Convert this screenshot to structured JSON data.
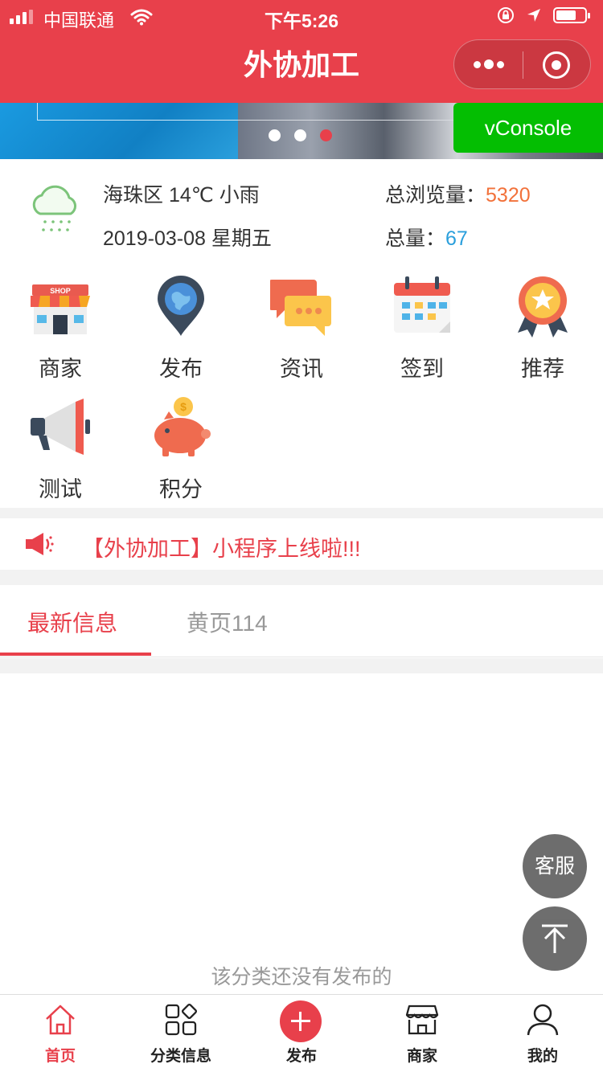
{
  "status_bar": {
    "carrier": "中国联通",
    "time": "下午5:26"
  },
  "nav": {
    "title": "外协加工"
  },
  "banner": {
    "active_index": 2,
    "count": 3
  },
  "vconsole": {
    "label": "vConsole"
  },
  "weather": {
    "location_temp": "海珠区 14℃ 小雨",
    "date": "2019-03-08 星期五",
    "icon": "cloud-rain-icon"
  },
  "stats": {
    "views_label": "总浏览量：",
    "views_value": "5320",
    "total_label": "总量：",
    "total_value": "67"
  },
  "menu": {
    "items": [
      {
        "label": "商家",
        "icon": "shop-icon"
      },
      {
        "label": "发布",
        "icon": "location-pin-icon"
      },
      {
        "label": "资讯",
        "icon": "chat-bubbles-icon"
      },
      {
        "label": "签到",
        "icon": "calendar-icon"
      },
      {
        "label": "推荐",
        "icon": "award-badge-icon"
      },
      {
        "label": "测试",
        "icon": "megaphone-icon"
      },
      {
        "label": "积分",
        "icon": "piggy-bank-icon"
      }
    ]
  },
  "notice": {
    "text": "【外协加工】小程序上线啦!!!",
    "icon": "speaker-icon"
  },
  "tabs": {
    "items": [
      {
        "label": "最新信息",
        "active": true
      },
      {
        "label": "黄页114",
        "active": false
      }
    ]
  },
  "content": {
    "empty_text": "该分类还没有发布的"
  },
  "floating": {
    "service_label": "客服",
    "top_icon": "back-to-top-icon"
  },
  "tabbar": {
    "items": [
      {
        "label": "首页",
        "icon": "home-icon",
        "active": true
      },
      {
        "label": "分类信息",
        "icon": "category-icon",
        "active": false
      },
      {
        "label": "发布",
        "icon": "plus-icon",
        "active": false
      },
      {
        "label": "商家",
        "icon": "store-icon",
        "active": false
      },
      {
        "label": "我的",
        "icon": "user-icon",
        "active": false
      }
    ]
  },
  "colors": {
    "brand_red": "#e8404b",
    "views_number": "#f2713a",
    "total_number": "#2a9fdc",
    "vconsole_green": "#04be02"
  }
}
